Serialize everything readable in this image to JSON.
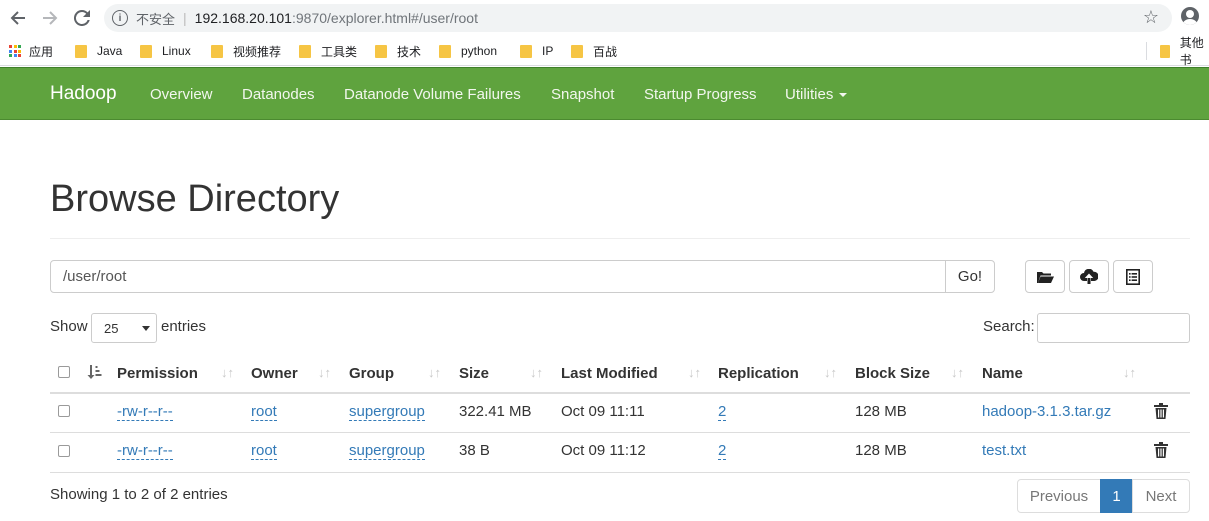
{
  "browser": {
    "security_label": "不安全",
    "url_host": "192.168.20.101",
    "url_rest": ":9870/explorer.html#/user/root",
    "bookmarks": [
      "应用",
      "Java",
      "Linux",
      "视频推荐",
      "工具类",
      "技术",
      "python",
      "IP",
      "百战",
      "其他书"
    ]
  },
  "navbar": {
    "brand": "Hadoop",
    "items": [
      "Overview",
      "Datanodes",
      "Datanode Volume Failures",
      "Snapshot",
      "Startup Progress",
      "Utilities"
    ]
  },
  "page": {
    "title": "Browse Directory",
    "path_value": "/user/root",
    "go_label": "Go!",
    "show_label": "Show",
    "page_size": "25",
    "entries_label": "entries",
    "search_label": "Search:",
    "search_value": ""
  },
  "table": {
    "columns": [
      "Permission",
      "Owner",
      "Group",
      "Size",
      "Last Modified",
      "Replication",
      "Block Size",
      "Name"
    ],
    "rows": [
      {
        "permission": "-rw-r--r--",
        "owner": "root",
        "group": "supergroup",
        "size": "322.41 MB",
        "modified": "Oct 09 11:11",
        "replication": "2",
        "block_size": "128 MB",
        "name": "hadoop-3.1.3.tar.gz"
      },
      {
        "permission": "-rw-r--r--",
        "owner": "root",
        "group": "supergroup",
        "size": "38 B",
        "modified": "Oct 09 11:12",
        "replication": "2",
        "block_size": "128 MB",
        "name": "test.txt"
      }
    ]
  },
  "footer": {
    "info": "Showing 1 to 2 of 2 entries",
    "previous": "Previous",
    "current_page": "1",
    "next": "Next"
  },
  "colors": {
    "navbar": "#5fa33e",
    "link": "#337ab7",
    "active_page": "#337ab7"
  }
}
